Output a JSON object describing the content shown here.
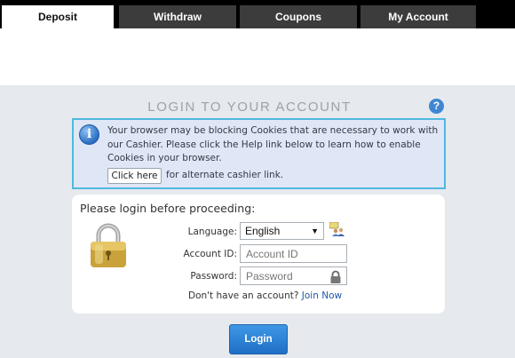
{
  "tabs": [
    {
      "label": "Deposit",
      "active": true
    },
    {
      "label": "Withdraw",
      "active": false
    },
    {
      "label": "Coupons",
      "active": false
    },
    {
      "label": "My Account",
      "active": false
    }
  ],
  "login": {
    "heading": "LOGIN TO YOUR ACCOUNT",
    "help_icon": "?",
    "info": {
      "icon": "i",
      "text": "Your browser may be blocking Cookies that are necessary to work with our Cashier. Please click the Help link below to learn how to enable Cookies in your browser.",
      "click_here_label": "Click here",
      "alt_text": "for alternate cashier link."
    },
    "card_title": "Please login before proceeding:",
    "language_label": "Language:",
    "language_value": "English",
    "account_label": "Account ID:",
    "account_placeholder": "Account ID",
    "password_label": "Password:",
    "password_placeholder": "Password",
    "signup_text": "Don't have an account?",
    "join_label": "Join Now",
    "login_button": "Login"
  },
  "colors": {
    "accent": "#2a7fd4",
    "info_border": "#4fb8e0",
    "panel_bg": "#e6e9ed"
  }
}
